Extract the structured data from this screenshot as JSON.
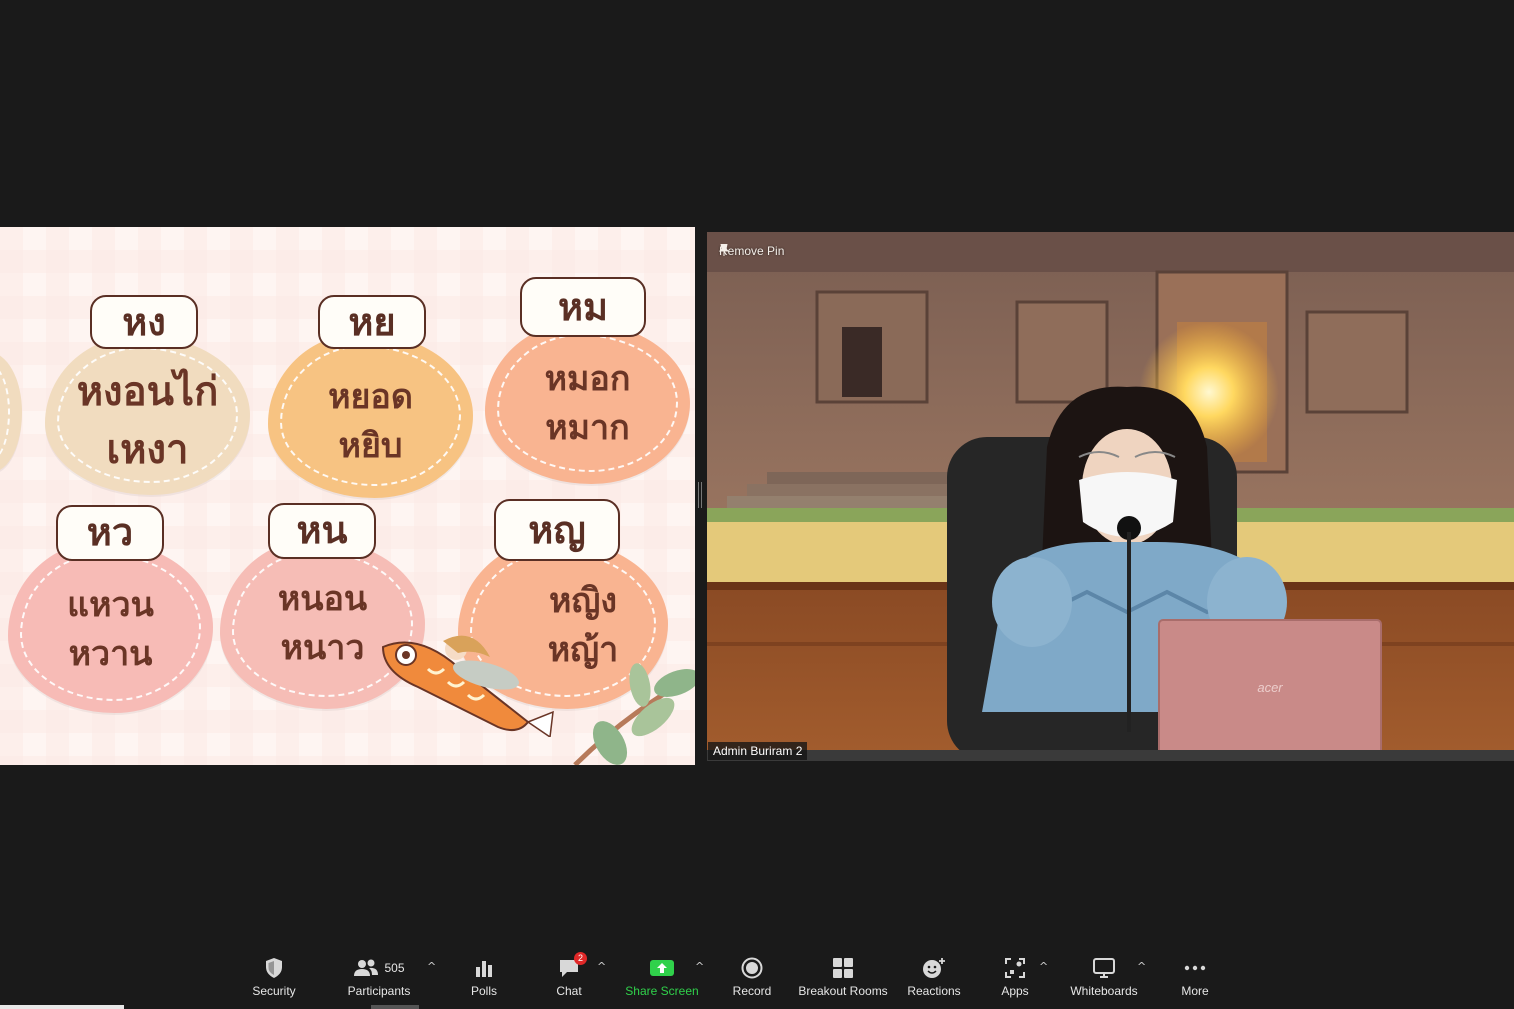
{
  "shared_slide": {
    "cards": [
      {
        "header": "หง",
        "words": [
          "หงอนไก่",
          "เหงา"
        ],
        "color": "#f1dcbf"
      },
      {
        "header": "หย",
        "words": [
          "หยอด",
          "หยิบ"
        ],
        "color": "#f7c382"
      },
      {
        "header": "หม",
        "words": [
          "หมอก",
          "หมาก"
        ],
        "color": "#f9b491"
      },
      {
        "header": "หว",
        "words": [
          "แหวน",
          "หวาน"
        ],
        "color": "#f7bbb6"
      },
      {
        "header": "หน",
        "words": [
          "หนอน",
          "หนาว"
        ],
        "color": "#f6bdb6"
      },
      {
        "header": "หญ",
        "words": [
          "หญิง",
          "หญ้า"
        ],
        "color": "#f9b491"
      }
    ]
  },
  "video": {
    "remove_pin": "Remove Pin",
    "participant_name": "Admin Buriram 2",
    "laptop_brand": "acer"
  },
  "toolbar": {
    "security": "Security",
    "participants": "Participants",
    "participants_count": "505",
    "polls": "Polls",
    "chat": "Chat",
    "chat_badge": "2",
    "share_screen": "Share Screen",
    "record": "Record",
    "breakout_rooms": "Breakout Rooms",
    "reactions": "Reactions",
    "apps": "Apps",
    "whiteboards": "Whiteboards",
    "more": "More",
    "caret": "^"
  }
}
